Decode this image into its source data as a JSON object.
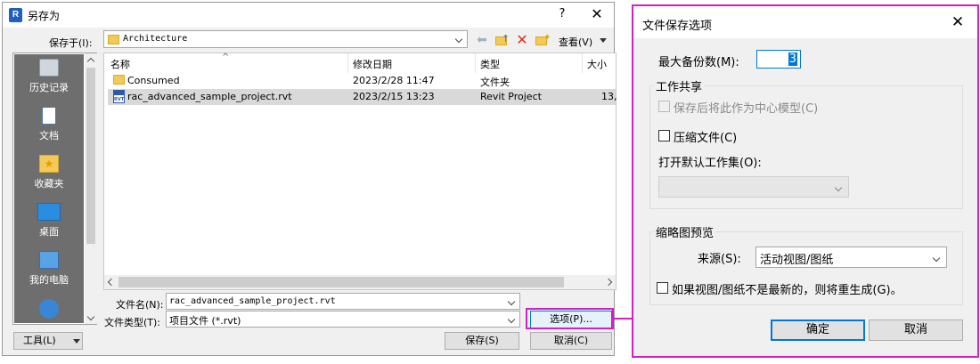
{
  "save_dialog": {
    "title": "另存为",
    "app_icon_letter": "R",
    "help": "?",
    "close": "✕",
    "save_in_label": "保存于(I):",
    "save_in_value": "Architecture",
    "view_menu_label": "查看(V)",
    "places": [
      {
        "label": "历史记录",
        "icon": "history-icon"
      },
      {
        "label": "文档",
        "icon": "documents-icon"
      },
      {
        "label": "收藏夹",
        "icon": "favorites-icon"
      },
      {
        "label": "桌面",
        "icon": "desktop-icon"
      },
      {
        "label": "我的电脑",
        "icon": "computer-icon"
      }
    ],
    "columns": {
      "name": "名称",
      "modified": "修改日期",
      "type": "类型",
      "size": "大小"
    },
    "files": [
      {
        "name": "Consumed",
        "modified": "2023/2/28 11:47",
        "type": "文件夹",
        "size": "",
        "icon": "folder-icon"
      },
      {
        "name": "rac_advanced_sample_project.rvt",
        "modified": "2023/2/15 13:23",
        "type": "Revit Project",
        "size": "13,",
        "icon": "rvt-file-icon"
      }
    ],
    "filename_label": "文件名(N):",
    "filename_value": "rac_advanced_sample_project.rvt",
    "filetype_label": "文件类型(T):",
    "filetype_value": "项目文件 (*.rvt)",
    "options_button": "选项(P)...",
    "tools_button": "工具(L)",
    "save_button": "保存(S)",
    "cancel_button": "取消(C)",
    "rvt_badge": "RVT"
  },
  "options_dialog": {
    "title": "文件保存选项",
    "close": "✕",
    "max_backups_label": "最大备份数(M):",
    "max_backups_value": "3",
    "worksharing_group": "工作共享",
    "make_central_label": "保存后将此作为中心模型(C)",
    "make_central_checked": false,
    "make_central_enabled": false,
    "compact_label": "压缩文件(C)",
    "compact_checked": false,
    "open_worksets_label": "打开默认工作集(O):",
    "open_worksets_value": "",
    "thumbnail_group": "缩略图预览",
    "source_label": "来源(S):",
    "source_value": "活动视图/图纸",
    "regenerate_label": "如果视图/图纸不是最新的，则将重生成(G)。",
    "regenerate_checked": false,
    "ok_button": "确定",
    "cancel_button": "取消"
  },
  "colors": {
    "highlight": "#d41fc1",
    "accent": "#0078d7"
  }
}
